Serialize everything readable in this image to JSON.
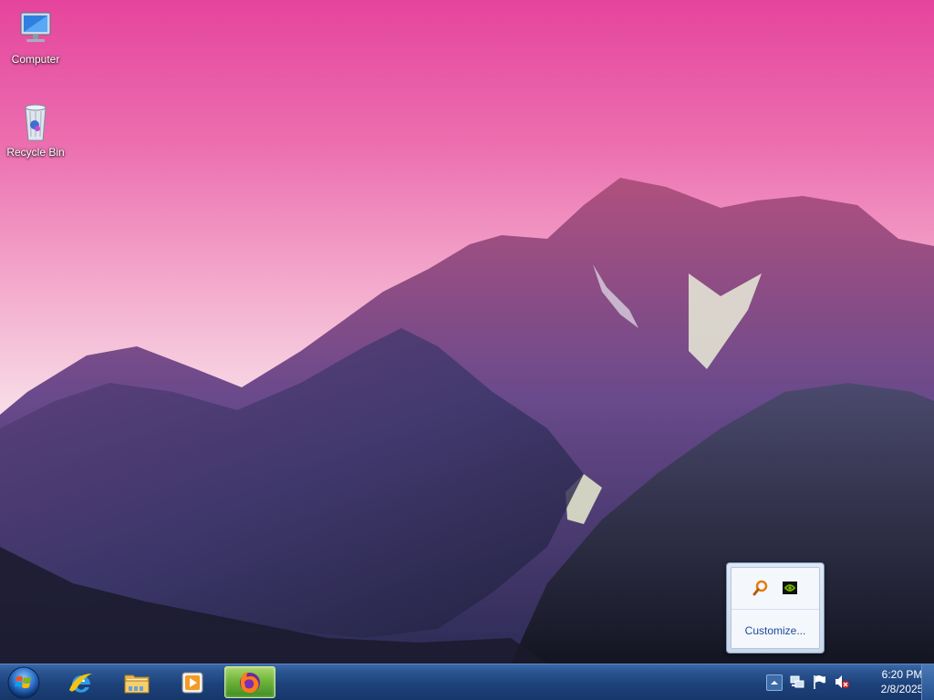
{
  "desktop": {
    "icons": [
      {
        "label": "Computer",
        "icon": "computer-icon"
      },
      {
        "label": "Recycle Bin",
        "icon": "recycle-bin-icon"
      }
    ]
  },
  "tray_popup": {
    "icons": [
      "magnifier-icon",
      "nvidia-icon"
    ],
    "customize_label": "Customize..."
  },
  "taskbar": {
    "start_icon": "windows-start-icon",
    "pinned": [
      {
        "name": "Internet Explorer",
        "icon": "internet-explorer-icon",
        "active": false
      },
      {
        "name": "Windows Explorer",
        "icon": "folder-icon",
        "active": false
      },
      {
        "name": "Windows Media Player",
        "icon": "media-player-icon",
        "active": false
      },
      {
        "name": "Firefox",
        "icon": "firefox-icon",
        "active": true
      }
    ],
    "tray_icons": [
      "show-hidden-icons-arrow-icon",
      "network-icon",
      "action-center-flag-icon",
      "volume-muted-icon"
    ],
    "clock": {
      "time": "6:20 PM",
      "date": "2/8/2025"
    }
  },
  "colors": {
    "sky_top": "#e5449c",
    "sky_bottom": "#f4e6ea",
    "taskbar": "#1d427a",
    "active_task": "#6fb53b"
  }
}
